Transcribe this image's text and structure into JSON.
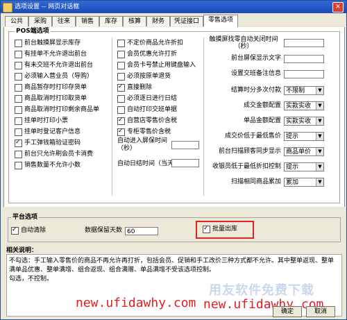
{
  "window": {
    "title": "选项设置 -- 网页对话框",
    "close_glyph": "×"
  },
  "tabs": [
    "公共",
    "采购",
    "往来",
    "销售",
    "库存",
    "核算",
    "财务",
    "凭证接口",
    "零售选项"
  ],
  "pos_group": {
    "label": "POS端选项",
    "col1": [
      {
        "label": "前台触摸屏显示库存",
        "checked": false
      },
      {
        "label": "有挂单不允许退出前台",
        "checked": false
      },
      {
        "label": "有未交班不允许退出前台",
        "checked": false
      },
      {
        "label": "必须输入营业员（导购）",
        "checked": false
      },
      {
        "label": "商品暂存时打印存货单",
        "checked": false
      },
      {
        "label": "商品取消时打印取货单",
        "checked": false
      },
      {
        "label": "商品取消时打印剩余商品单",
        "checked": false
      },
      {
        "label": "挂单时打印小票",
        "checked": false
      },
      {
        "label": "挂单时登记客户信息",
        "checked": false
      },
      {
        "label": "手工弹钱箱验证密码",
        "checked": true
      },
      {
        "label": "前台只允许刷会员卡消费",
        "checked": false
      },
      {
        "label": "销售数量不允许小数",
        "checked": false
      }
    ],
    "col2": [
      {
        "label": "不定价商品允许折扣",
        "checked": false
      },
      {
        "label": "会员优惠允许打折",
        "checked": false
      },
      {
        "label": "会员卡号禁止用键盘输入",
        "checked": false
      },
      {
        "label": "必须按原单退货",
        "checked": false
      },
      {
        "label": "直接删除",
        "checked": true
      },
      {
        "label": "必须逐日进行日结",
        "checked": false
      },
      {
        "label": "自动打印交班单据",
        "checked": false
      },
      {
        "label": "自营店零售价含税",
        "checked": true
      },
      {
        "label": "专柜零售价含税",
        "checked": true
      }
    ],
    "col2_fields": [
      {
        "label": "自动进入屏保时间（秒）",
        "value": ""
      },
      {
        "label": "自动日结时间（当天）",
        "value": ""
      }
    ],
    "col3_inputs": [
      {
        "label": "触摸屏找零自动关闭时间（秒）",
        "value": ""
      },
      {
        "label": "前台屏保显示文字",
        "value": ""
      },
      {
        "label": "设置交班备注信息",
        "value": ""
      }
    ],
    "col3_selects": [
      {
        "label": "结算时分多次付款",
        "value": "不限制"
      },
      {
        "label": "成交金额配置",
        "value": "实款实收"
      },
      {
        "label": "单品金额配置",
        "value": "实款实收"
      },
      {
        "label": "成交价低于最低售价",
        "value": "提示"
      },
      {
        "label": "前台扫描顾客同步显示",
        "value": "商品单价"
      },
      {
        "label": "收银员低于最低折扣控制",
        "value": "提示"
      },
      {
        "label": "扫描相同商品累加",
        "value": "累加"
      }
    ]
  },
  "platform": {
    "label": "平台选项",
    "auto_clear": {
      "label": "自动清除",
      "checked": true
    },
    "retain_days_label": "数据保留天数",
    "retain_days_value": "60",
    "batch_out": {
      "label": "批量出库",
      "checked": true
    }
  },
  "help": {
    "title": "相关说明：",
    "text": "不勾选：手工输入零售价的商品不再允许再打折，包括会员、促销和手工改价三种方式都不允许。其中整单返现、整单满单品优惠、整单满增、组合返现、组合满赠、单品满增不受该选项控制。",
    "text2": "勾选，不控制。"
  },
  "watermark": {
    "cn": "用友软件免费下载",
    "url1": "new.ufidawhy.com",
    "url2": "new.ufidawhy.com"
  },
  "buttons": {
    "ok": "确定",
    "cancel": "取消"
  },
  "colors": {
    "title_bar": "#1c4bb8",
    "highlight": "#e02222",
    "watermark_url": "#e01f1f"
  }
}
